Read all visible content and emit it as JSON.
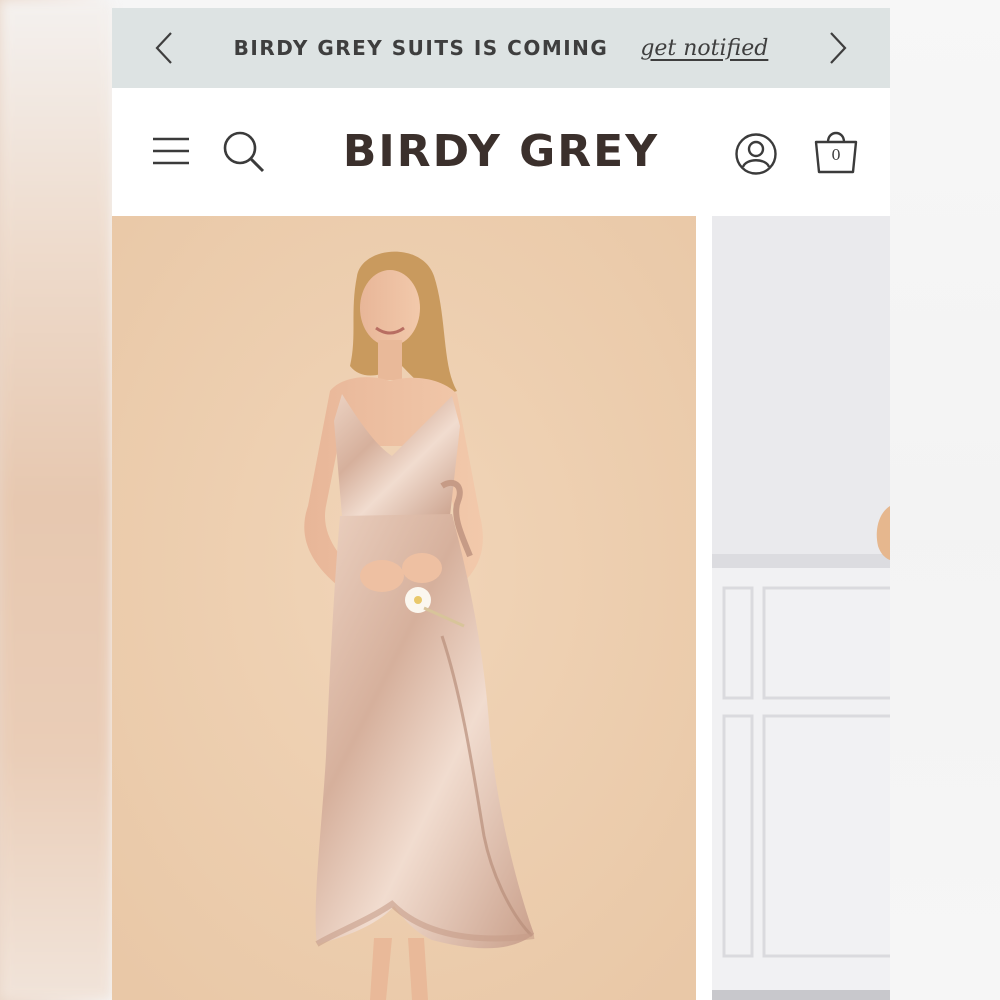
{
  "announcement": {
    "text": "BIRDY GREY SUITS IS COMING",
    "link": "get notified",
    "prev_icon": "chevron-left-icon",
    "next_icon": "chevron-right-icon"
  },
  "header": {
    "logo": "BIRDY GREY",
    "menu_icon": "hamburger-menu-icon",
    "search_icon": "search-icon",
    "account_icon": "account-icon",
    "cart_icon": "shopping-bag-icon",
    "cart_count": "0"
  },
  "colors": {
    "announcement_bg": "#dde3e3",
    "logo": "#3b302c",
    "product_bg": "#efcfae",
    "dress": "#d9b5a2"
  },
  "products": [
    {
      "image": "model in blush satin wrap dress with ruffle hem holding white flower"
    },
    {
      "image": "partial view of next product on grey paneled background"
    }
  ]
}
